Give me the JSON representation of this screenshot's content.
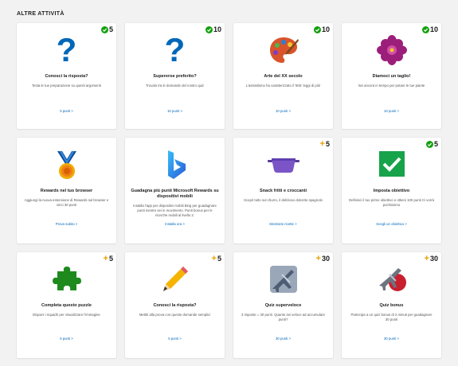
{
  "section": {
    "title": "ALTRE ATTIVITÀ"
  },
  "colors": {
    "check": "#13a10e",
    "plus": "#e8a000",
    "link": "#0067b8",
    "question": "#0067b8"
  },
  "cards": [
    {
      "icon": "question-mark-icon",
      "badge_type": "check",
      "points": "5",
      "title": "Conosci la risposta?",
      "desc": "Testa le tue preparazione su questi argomenti",
      "link": "5 punti >"
    },
    {
      "icon": "question-mark-icon",
      "badge_type": "check",
      "points": "10",
      "title": "Supereroe preferito?",
      "desc": "Trovalo tra le domande del nostro quiz",
      "link": "10 punti >"
    },
    {
      "icon": "palette-icon",
      "badge_type": "check",
      "points": "10",
      "title": "Arte del XX secolo",
      "desc": "L'astrattismo ha caratterizzato il '900: leggi di più!",
      "link": "10 punti >"
    },
    {
      "icon": "flower-icon",
      "badge_type": "check",
      "points": "10",
      "title": "Diamoci un taglio!",
      "desc": "Sei ancora in tempo per potare le tue piante",
      "link": "10 punti >"
    },
    {
      "icon": "medal-icon",
      "badge_type": "none",
      "points": "",
      "title": "Rewards nel tuo browser",
      "desc": "Aggiungi la nuova estensione di Rewards sul browser e vinci 30 punti",
      "link": "Prova subito >"
    },
    {
      "icon": "bing-logo-icon",
      "badge_type": "none",
      "points": "",
      "title": "Guadagna più punti Microsoft Rewards su dispositivi mobili",
      "desc": "Installa l'app per dispositivi mobili Bing per guadagnare punti mentre sei in movimento. Punti bonus per le ricerche mobili al livello 2.",
      "link": "Installa ora >"
    },
    {
      "icon": "pan-icon",
      "badge_type": "plus",
      "points": "5",
      "title": "Snack fritti e croccanti",
      "desc": "Scopri tutto sul churro, il delizioso dolcetto spagnolo",
      "link": "Mostrami ricette >"
    },
    {
      "icon": "checkbox-icon",
      "badge_type": "check",
      "points": "5",
      "title": "Imposta obiettivo",
      "desc": "Definisci il tuo primo obiettivo e ottieni 100 punti Ci vorrà pochissimo",
      "link": "Scegli un obiettivo >"
    },
    {
      "icon": "puzzle-icon",
      "badge_type": "plus",
      "points": "5",
      "title": "Completa questo puzzle",
      "desc": "Disponi i riquadri per visualizzare l'immagine",
      "link": "5 punti >"
    },
    {
      "icon": "pencil-icon",
      "badge_type": "plus",
      "points": "5",
      "title": "Conosci la risposta?",
      "desc": "Mettiti alla prova con queste domande semplici",
      "link": "5 punti >"
    },
    {
      "icon": "jet-icon",
      "badge_type": "plus",
      "points": "30",
      "title": "Quiz superveloce",
      "desc": "3 risposte = 30 punti. Quanto sei veloce ad accumulare punti?",
      "link": "30 punti >"
    },
    {
      "icon": "bonus-jet-icon",
      "badge_type": "plus",
      "points": "30",
      "title": "Quiz bonus",
      "desc": "Partecipa a un quiz bonus di 2 minuti per guadagnare 30 punti",
      "link": "30 punti >"
    }
  ]
}
